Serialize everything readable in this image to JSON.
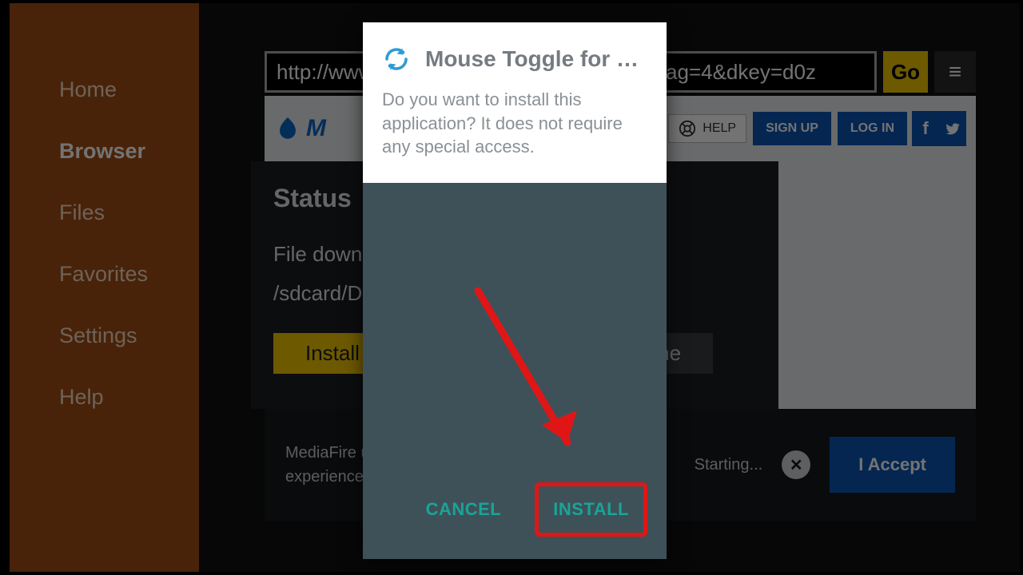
{
  "sidebar": {
    "items": [
      {
        "label": "Home"
      },
      {
        "label": "Browser"
      },
      {
        "label": "Files"
      },
      {
        "label": "Favorites"
      },
      {
        "label": "Settings"
      },
      {
        "label": "Help"
      }
    ]
  },
  "urlbar": {
    "value": "http://www.mediafire.com/download.php?flag=4&dkey=d0z",
    "go_label": "Go",
    "menu_glyph": "≡"
  },
  "site": {
    "brand_initial": "M",
    "help_label": "HELP",
    "signup_label": "SIGN UP",
    "login_label": "LOG IN",
    "facebook_glyph": "f",
    "twitter_glyph": "t"
  },
  "status": {
    "title": "Status",
    "line1": "File downloaded",
    "line2": "/sdcard/Downloads/MouseToggle1.06.apk",
    "install_label": "Install",
    "done_label": "Done"
  },
  "cookie": {
    "text": "MediaFire uses cookies to give you the best browsing experience. By continuing you agree to our terms.",
    "starting_text": "Starting...",
    "close_glyph": "✕",
    "accept_label": "I Accept"
  },
  "dialog": {
    "title": "Mouse Toggle for Fir…",
    "message": "Do you want to install this application? It does not require any special access.",
    "cancel_label": "CANCEL",
    "install_label": "INSTALL"
  },
  "colors": {
    "sidebar_bg": "#a04e16",
    "accent_yellow": "#f2c600",
    "primary_blue": "#0a56b3",
    "dialog_bg": "#3e5159",
    "teal": "#1aa497",
    "annotation_red": "#e01616"
  }
}
